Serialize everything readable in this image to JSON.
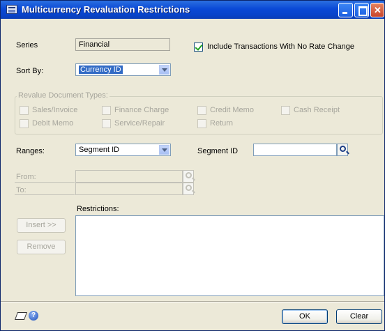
{
  "window": {
    "title": "Multicurrency Revaluation Restrictions"
  },
  "series": {
    "label": "Series",
    "value": "Financial"
  },
  "include_no_rate_change": {
    "label": "Include Transactions With No Rate Change",
    "checked": true
  },
  "sort_by": {
    "label": "Sort By:",
    "value": "Currency ID"
  },
  "revalue_doc_types": {
    "title": "Revalue Document Types:",
    "options": [
      "Sales/Invoice",
      "Finance Charge",
      "Credit Memo",
      "Cash Receipt",
      "Debit Memo",
      "Service/Repair",
      "Return"
    ]
  },
  "ranges": {
    "label": "Ranges:",
    "value": "Segment ID"
  },
  "segment_id": {
    "label": "Segment ID",
    "value": ""
  },
  "from": {
    "label": "From:",
    "value": ""
  },
  "to": {
    "label": "To:",
    "value": ""
  },
  "restrictions": {
    "label": "Restrictions:"
  },
  "buttons": {
    "insert": "Insert >>",
    "remove": "Remove",
    "ok": "OK",
    "clear": "Clear"
  },
  "icons": [
    "title-window-icon",
    "minimize-icon",
    "maximize-icon",
    "close-icon",
    "dropdown-arrow-icon",
    "lookup-icon",
    "note-icon",
    "help-icon"
  ]
}
